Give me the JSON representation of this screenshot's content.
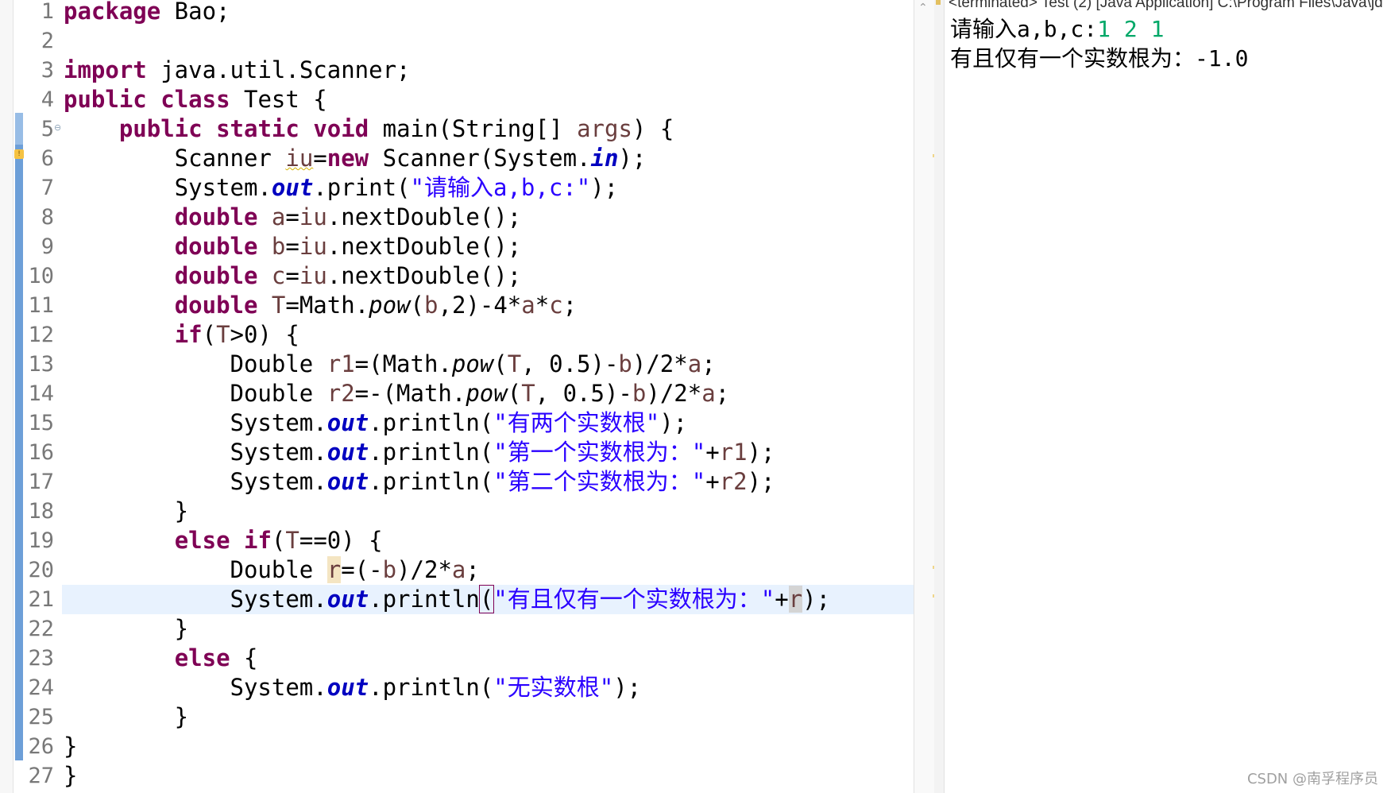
{
  "editor": {
    "line_numbers": [
      "1",
      "2",
      "3",
      "4",
      "5",
      "6",
      "7",
      "8",
      "9",
      "10",
      "11",
      "12",
      "13",
      "14",
      "15",
      "16",
      "17",
      "18",
      "19",
      "20",
      "21",
      "22",
      "23",
      "24",
      "25",
      "26",
      "27"
    ],
    "fold_glyph": "⊖",
    "warn_glyph": "!",
    "current_line": 21
  },
  "tokens": {
    "t1": "package",
    "t2": " Bao;",
    "t3": "import",
    "t4": " java.util.Scanner;",
    "t5": "public",
    "t6": " ",
    "t7": "class",
    "t8": " Test {",
    "t9": "    ",
    "t10": "public",
    "t11": " ",
    "t12": "static",
    "t13": " ",
    "t14": "void",
    "t15": " main(String[] ",
    "t16": "args",
    "t17": ") {",
    "t18": "        Scanner ",
    "t19": "iu",
    "t20": "=",
    "t21": "new",
    "t22": " Scanner(System.",
    "t23": "in",
    "t24": ");",
    "t25": "        System.",
    "t26": "out",
    "t27": ".print(",
    "t28": "\"请输入a,b,c:\"",
    "t29": ");",
    "t30": "        ",
    "t31": "double",
    "t32": " ",
    "t33": "a",
    "t34": "=",
    "t35": "iu",
    "t36": ".nextDouble();",
    "t37": "        ",
    "t38": "double",
    "t39": " ",
    "t40": "b",
    "t41": "=",
    "t42": "iu",
    "t43": ".nextDouble();",
    "t44": "        ",
    "t45": "double",
    "t46": " ",
    "t47": "c",
    "t48": "=",
    "t49": "iu",
    "t50": ".nextDouble();",
    "t51": "        ",
    "t52": "double",
    "t53": " ",
    "t54": "T",
    "t55": "=Math.",
    "t56": "pow",
    "t57": "(",
    "t58": "b",
    "t59": ",2)-4*",
    "t60": "a",
    "t61": "*",
    "t62": "c",
    "t63": ";",
    "t64": "        ",
    "t65": "if",
    "t66": "(",
    "t67": "T",
    "t68": ">0) {",
    "t69": "            Double ",
    "t70": "r1",
    "t71": "=(Math.",
    "t72": "pow",
    "t73": "(",
    "t74": "T",
    "t75": ", 0.5)-",
    "t76": "b",
    "t77": ")/2*",
    "t78": "a",
    "t79": ";",
    "t80": "            Double ",
    "t81": "r2",
    "t82": "=-(Math.",
    "t83": "pow",
    "t84": "(",
    "t85": "T",
    "t86": ", 0.5)-",
    "t87": "b",
    "t88": ")/2*",
    "t89": "a",
    "t90": ";",
    "t91": "            System.",
    "t92": "out",
    "t93": ".println(",
    "t94": "\"有两个实数根\"",
    "t95": ");",
    "t96": "            System.",
    "t97": "out",
    "t98": ".println(",
    "t99": "\"第一个实数根为：\"",
    "t100": "+",
    "t101": "r1",
    "t102": ");",
    "t103": "            System.",
    "t104": "out",
    "t105": ".println(",
    "t106": "\"第二个实数根为：\"",
    "t107": "+",
    "t108": "r2",
    "t109": ");",
    "t110": "        }",
    "t111": "        ",
    "t112": "else",
    "t113": " ",
    "t114": "if",
    "t115": "(",
    "t116": "T",
    "t117": "==0) {",
    "t118": "            Double ",
    "t119": "r",
    "t120": "=(-",
    "t121": "b",
    "t122": ")/2*",
    "t123": "a",
    "t124": ";",
    "t125": "            System.",
    "t126": "out",
    "t127": ".println",
    "t128": "(",
    "t129": "\"有且仅有一个实数根为：\"",
    "t130": "+",
    "t131": "r",
    "t132": ");",
    "t133": "        }",
    "t134": "        ",
    "t135": "else",
    "t136": " {",
    "t137": "            System.",
    "t138": "out",
    "t139": ".println(",
    "t140": "\"无实数根\"",
    "t141": ");",
    "t142": "        }",
    "t143": "}",
    "t144": "}"
  },
  "console": {
    "title": "<terminated> Test (2) [Java Application] C:\\Program Files\\Java\\jd",
    "prompt": "请输入a,b,c:",
    "input": "1 2 1",
    "result": "有且仅有一个实数根为：-1.0"
  },
  "scroll_up_glyph": "⌃",
  "watermark": "CSDN @南孚程序员",
  "colors": {
    "keyword": "#7f0055",
    "string": "#2a00ff",
    "field": "#0000c0",
    "local_variable": "#6a3e3e",
    "current_line": "#e8f2fe",
    "gutter_bar": "#6d9fd8",
    "console_input": "#00a868"
  }
}
